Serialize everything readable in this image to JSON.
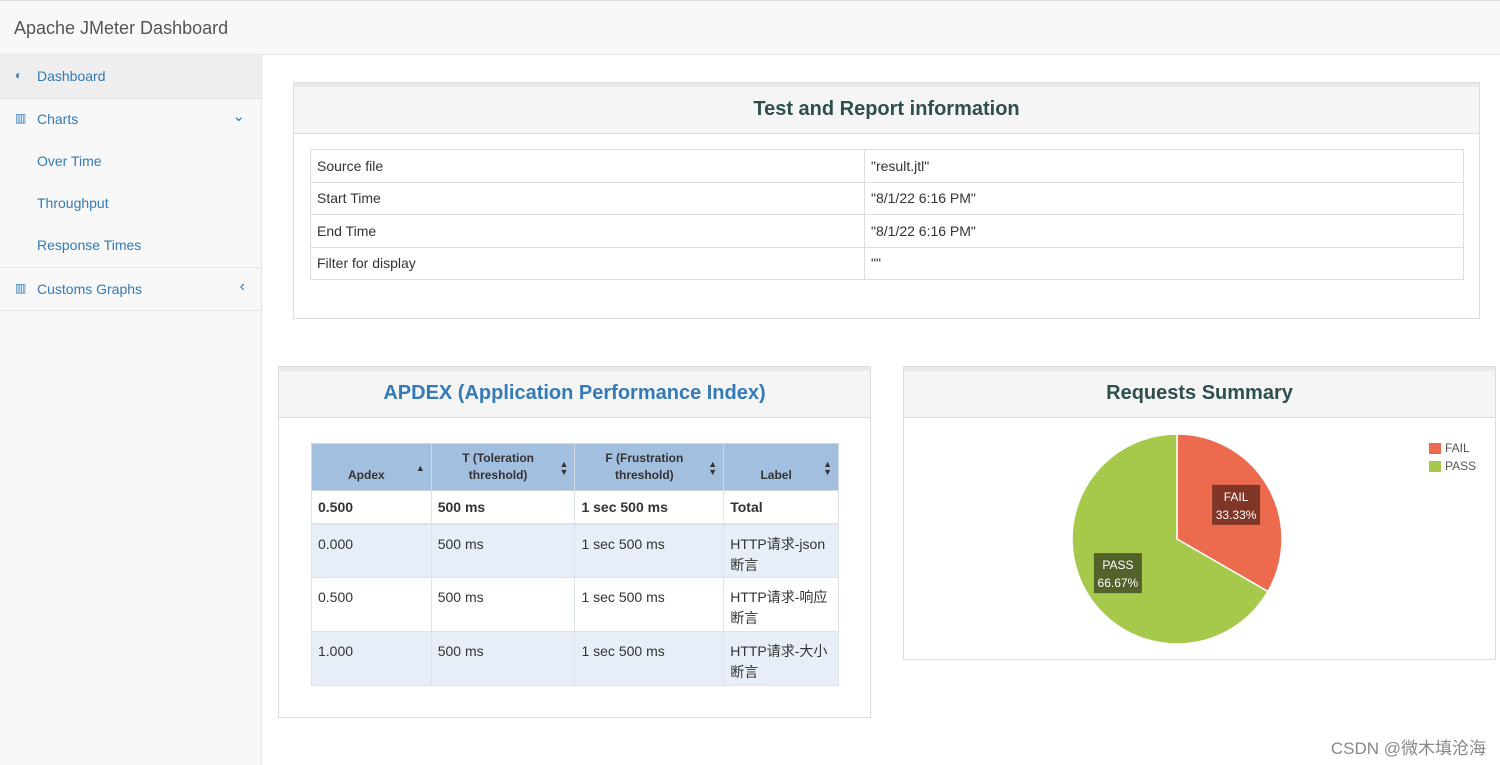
{
  "app": {
    "title": "Apache JMeter Dashboard"
  },
  "sidebar": {
    "items": [
      {
        "label": "Dashboard",
        "icon": "dashboard-icon",
        "glyph": "◐"
      },
      {
        "label": "Charts",
        "icon": "bar-chart-icon",
        "glyph": "▥",
        "caret": "⌄"
      },
      {
        "label": "Customs Graphs",
        "icon": "bar-chart-icon",
        "glyph": "▥",
        "caret": "‹"
      }
    ],
    "charts_sub": [
      "Over Time",
      "Throughput",
      "Response Times"
    ]
  },
  "report_info": {
    "title": "Test and Report information",
    "rows": [
      {
        "key": "Source file",
        "value": "\"result.jtl\""
      },
      {
        "key": "Start Time",
        "value": "\"8/1/22 6:16 PM\""
      },
      {
        "key": "End Time",
        "value": "\"8/1/22 6:16 PM\""
      },
      {
        "key": "Filter for display",
        "value": "\"\""
      }
    ]
  },
  "apdex": {
    "title": "APDEX (Application Performance Index)",
    "columns": [
      "Apdex",
      "T (Toleration threshold)",
      "F (Frustration threshold)",
      "Label"
    ],
    "total": {
      "apdex": "0.500",
      "t": "500 ms",
      "f": "1 sec 500 ms",
      "label": "Total"
    },
    "rows": [
      {
        "apdex": "0.000",
        "t": "500 ms",
        "f": "1 sec 500 ms",
        "label": "HTTP请求-json断言"
      },
      {
        "apdex": "0.500",
        "t": "500 ms",
        "f": "1 sec 500 ms",
        "label": "HTTP请求-响应断言"
      },
      {
        "apdex": "1.000",
        "t": "500 ms",
        "f": "1 sec 500 ms",
        "label": "HTTP请求-大小断言"
      }
    ]
  },
  "requests_summary": {
    "title": "Requests Summary",
    "legend": [
      {
        "name": "FAIL",
        "color": "#ec6b4e"
      },
      {
        "name": "PASS",
        "color": "#a6c94c"
      }
    ]
  },
  "chart_data": {
    "type": "pie",
    "title": "Requests Summary",
    "slices": [
      {
        "name": "FAIL",
        "value": 33.33,
        "label": "33.33%",
        "color": "#ec6b4e"
      },
      {
        "name": "PASS",
        "value": 66.67,
        "label": "66.67%",
        "color": "#a6c94c"
      }
    ]
  },
  "watermark": "CSDN @微木填沧海",
  "colors": {
    "link": "#337ab7",
    "apdex_title": "#337ab7",
    "header_bg": "#a3bfe0"
  }
}
